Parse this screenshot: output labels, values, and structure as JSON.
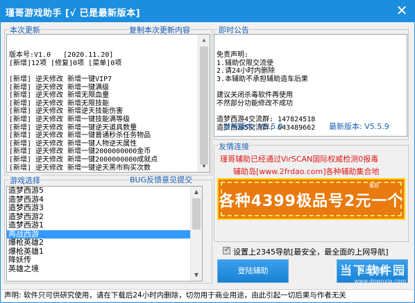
{
  "window": {
    "title": "瑾哥游戏助手 [√ 已是最新版本]",
    "close_glyph": "✕"
  },
  "update_panel": {
    "caption": "本次更新",
    "copy_link": "复制本次更新内容",
    "lines": [
      "版本号:V1.0   [2020.11.20]",
      "[新增]12项 [修复]0项 [菜单]0项",
      "",
      "[新增] 逆天修改 新增一键VIP7",
      "[新增] 逆天修改 新增一键满级",
      "[新增] 逆天修改 新增无限血量",
      "[新增] 逆天修改 新增无限技能",
      "[新增] 逆天修改 新增逆天技能伤害",
      "[新增] 逆天修改 新增一键技能满等级",
      "[新增] 逆天修改 新增一键逆天道具数量",
      "[新增] 逆天修改 新增一键普通秒杀任务物品",
      "[新增] 逆天修改 新增一键人物逆天属性",
      "[新增] 逆天修改 新增一键2000000000金币",
      "[新增] 逆天修改 新增一键2000000000成就点",
      "[新增] 逆天修改 新增一键逆天黑市购买次数"
    ]
  },
  "notice_panel": {
    "caption": "即时公告",
    "lines": [
      "免责声明:",
      "1.辅助仅限交流使",
      "2.请24小时内删除",
      "3.本辅助不承担辅助造车后果",
      "",
      "建议关闭杀毒软件再使用",
      "不然部分功能修改不成功",
      "",
      "造梦西游4交流群: 147824518",
      "造梦西游5交流群: 643489662"
    ],
    "current_version_label": "当前版本: V5.5.9",
    "latest_version_label": "最新版本: V5.5.9"
  },
  "game_select": {
    "caption": "游戏选择",
    "bug_link": "BUG反馈意见提交",
    "items": [
      "造梦西游5",
      "造梦西游4",
      "造梦西游3",
      "造梦西游2",
      "造梦西游1",
      "再战西游",
      "爆枪英雄2",
      "爆枪英雄1",
      "降妖传",
      "英雄之境"
    ],
    "selected_index": 5
  },
  "friend_links": {
    "caption": "友情连接",
    "line1": "瑾哥辅助已经通过VirSCAN国际权威检测0报毒",
    "line2": "辅助岛[www.2frdao.com]各种辅助集合地",
    "banner_text": "各种4399极品号2元一个",
    "banner_badge": "推荐"
  },
  "options": {
    "homepage_checkbox_label": "设置上2345导航[最安全，最全面的上网导航]",
    "checked": true
  },
  "buttons": {
    "login": "登陆辅助",
    "exit": "退出辅助"
  },
  "watermark": {
    "big": "当下软件园",
    "small": "www.downxia.com"
  },
  "status": {
    "text": "声明: 软件只可供研究使用，请在下载后24小时内删除，切勿用于商业用途，由此引起一切后果与作者无关"
  },
  "colors": {
    "titlebar": "#1c8ee0",
    "link": "#1a5fb4",
    "warning": "#e0191a",
    "banner": "#e97a0d",
    "selection": "#3399ff"
  }
}
